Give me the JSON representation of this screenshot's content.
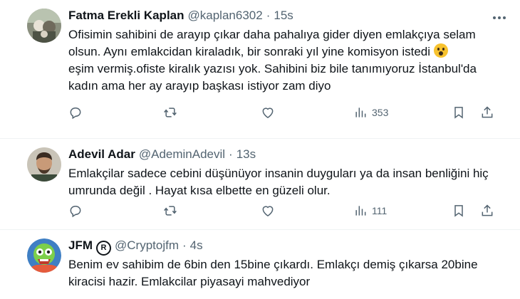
{
  "tweets": [
    {
      "name": "Fatma Erekli Kaplan",
      "handle": "@kaplan6302",
      "separator": "·",
      "time": "15s",
      "text_parts": [
        "Ofisimin sahibini de arayıp çıkar daha pahalıya gider diyen emlakçıya selam olsun. Aynı emlakcidan kiraladık, bir sonraki yıl yine komisyon istedi ",
        "\neşim vermiş.ofiste kiralık yazısı yok. Sahibini biz bile tanımıyoruz İstanbul'da kadın ama her ay arayıp başkası istiyor zam diyo"
      ],
      "emoji": "face-screaming-in-fear",
      "views": "353"
    },
    {
      "name": "Adevil Adar",
      "handle": "@AdeminAdevil",
      "separator": "·",
      "time": "13s",
      "text": "Emlakçilar sadece cebini düşünüyor insanin duyguları ya da insan benliğini hiç umrunda değil . Hayat kısa elbette en güzeli olur.",
      "views": "111"
    },
    {
      "name": "JFM",
      "badge": "R",
      "handle": "@Cryptojfm",
      "separator": "·",
      "time": "4s",
      "text": "Benim ev sahibim de 6bin den 15bine çıkardı. Emlakçı demiş çıkarsa 20bine kiracisi hazir. Emlakcilar piyasayi mahvediyor"
    }
  ],
  "colors": {
    "text": "#0f1419",
    "secondary": "#536471",
    "divider": "#eff3f4"
  }
}
